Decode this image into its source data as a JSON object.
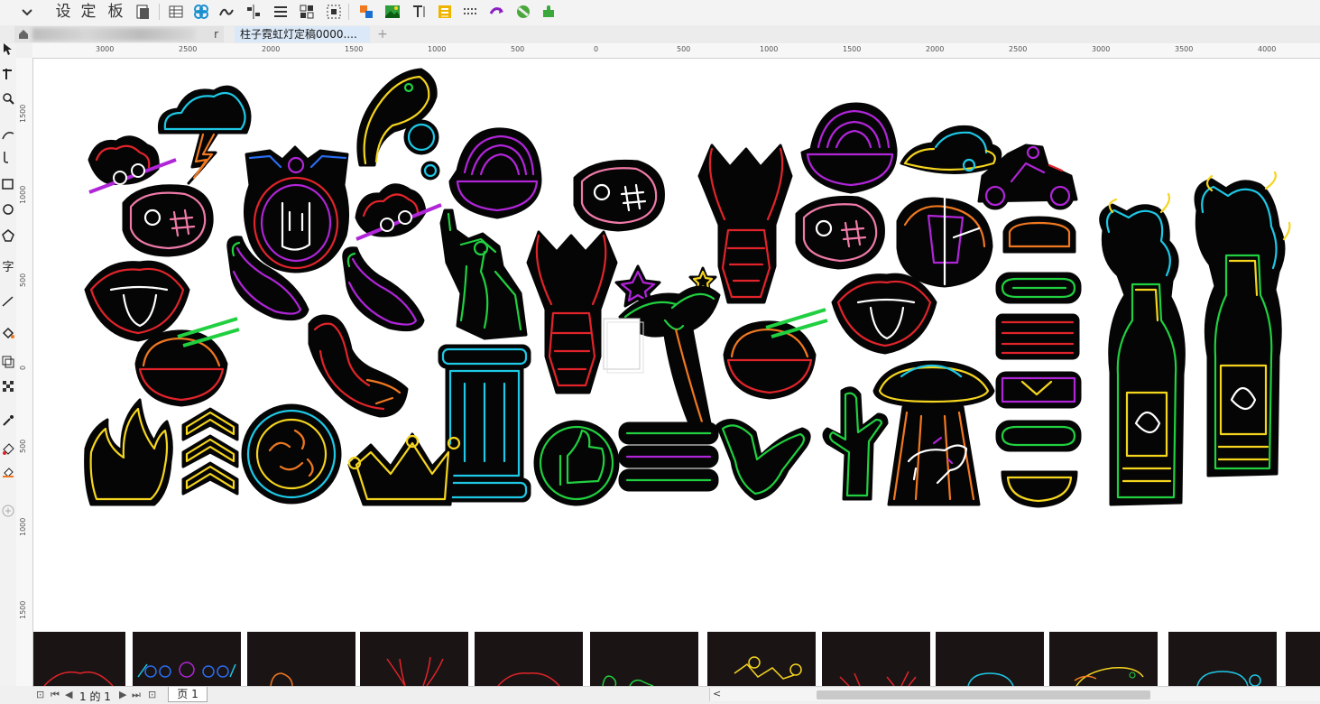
{
  "window": {
    "tabs": [
      {
        "label": "r",
        "active": false
      },
      {
        "label": "柱子霓虹灯定稿0000....",
        "active": true
      }
    ],
    "add_tab_symbol": "+"
  },
  "toolbar": {
    "chars": [
      "设",
      "定",
      "板"
    ],
    "icons": [
      "table-icon",
      "symbol-icon",
      "curve-icon",
      "align-icon",
      "distribute-icon",
      "group-icon",
      "select-icon",
      "shapes-icon",
      "image-icon",
      "text-frame-icon",
      "list-icon",
      "grid-icon",
      "arrow-icon",
      "globe-icon",
      "plugin-icon"
    ]
  },
  "toolbox": {
    "items": [
      "pick-tool",
      "shape-tool",
      "zoom-tool",
      "freehand-tool",
      "bezier-tool",
      "rectangle-tool",
      "ellipse-tool",
      "polygon-tool",
      "text-tool",
      "connector-tool",
      "fill-tool",
      "shadow-tool",
      "transparency-tool",
      "eyedropper-tool",
      "interactive-fill-tool",
      "smart-fill-tool",
      "add-tool"
    ]
  },
  "ruler": {
    "horizontal": [
      "3000",
      "2500",
      "2000",
      "1500",
      "1000",
      "500",
      "0",
      "500",
      "1000",
      "1500",
      "2000",
      "2500",
      "3000",
      "3500",
      "4000"
    ],
    "vertical": [
      "1500",
      "1000",
      "500",
      "0",
      "500",
      "1000",
      "1500"
    ]
  },
  "canvas": {
    "colors": {
      "red": "#e0242a",
      "cyan": "#1ec8e6",
      "yellow": "#f5d51e",
      "green": "#20d040",
      "purple": "#b025d8",
      "orange": "#f07820",
      "pink": "#f07aa8",
      "blue": "#2a6cf0",
      "black": "#050505"
    }
  },
  "statusbar": {
    "page_indicator": "1 的 1",
    "page_tab": "页 1"
  }
}
